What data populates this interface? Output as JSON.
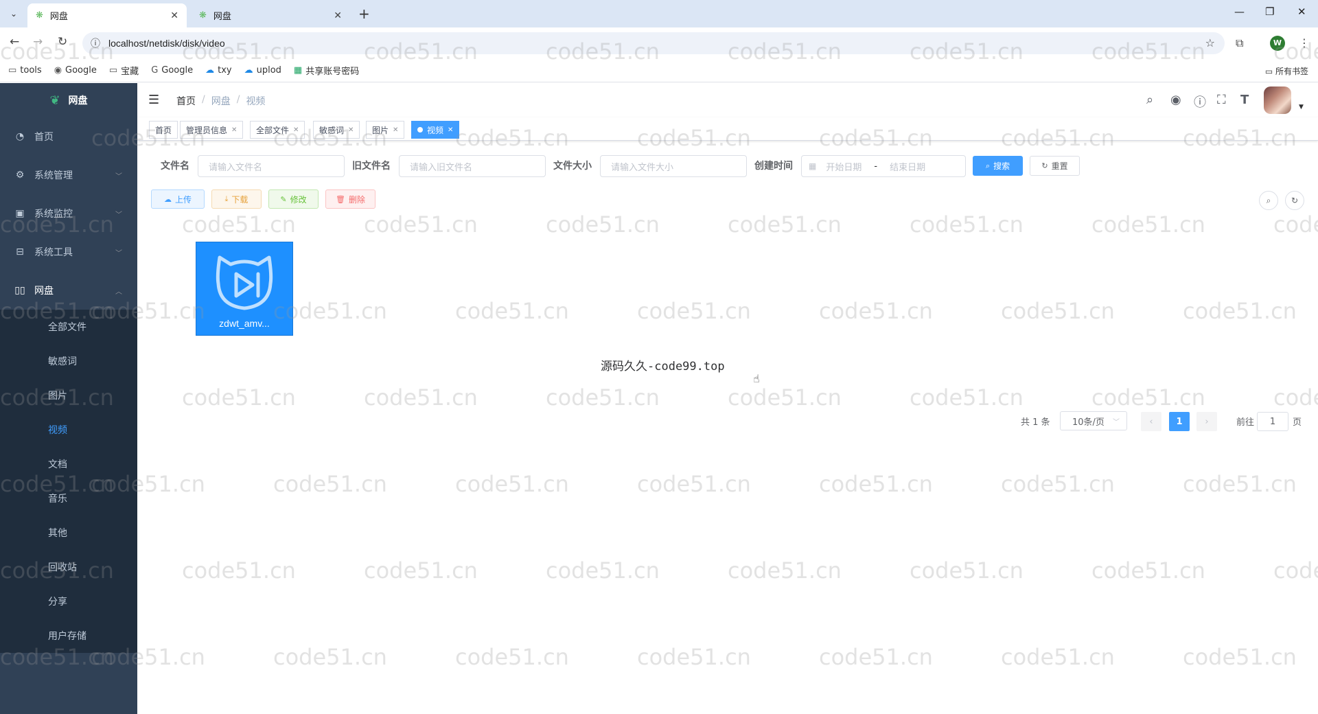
{
  "browser": {
    "tabs": [
      {
        "title": "网盘",
        "active": true
      },
      {
        "title": "网盘",
        "active": false
      }
    ],
    "url": "localhost/netdisk/disk/video",
    "profile_initial": "W",
    "bookmarks": [
      {
        "label": "tools",
        "icon": "folder-icon"
      },
      {
        "label": "Google",
        "icon": "globe-icon"
      },
      {
        "label": "宝藏",
        "icon": "folder-icon"
      },
      {
        "label": "Google",
        "icon": "google-icon"
      },
      {
        "label": "txy",
        "icon": "cloud-icon"
      },
      {
        "label": "uplod",
        "icon": "upload-cloud-icon"
      },
      {
        "label": "共享账号密码",
        "icon": "sheet-icon"
      }
    ],
    "all_bookmarks": "所有书签"
  },
  "app": {
    "logo_title": "网盘",
    "menu": [
      {
        "label": "首页",
        "icon": "dashboard-icon"
      },
      {
        "label": "系统管理",
        "icon": "gear-icon",
        "arrow": "down"
      },
      {
        "label": "系统监控",
        "icon": "monitor-icon",
        "arrow": "down"
      },
      {
        "label": "系统工具",
        "icon": "toolbox-icon",
        "arrow": "down"
      },
      {
        "label": "网盘",
        "icon": "book-icon",
        "arrow": "up"
      }
    ],
    "submenu": [
      "全部文件",
      "敏感词",
      "图片",
      "视频",
      "文档",
      "音乐",
      "其他",
      "回收站",
      "分享",
      "用户存储"
    ],
    "active_submenu": "视频",
    "breadcrumb": [
      "首页",
      "网盘",
      "视频"
    ],
    "tags": [
      {
        "label": "首页",
        "closable": false
      },
      {
        "label": "管理员信息",
        "closable": true
      },
      {
        "label": "全部文件",
        "closable": true
      },
      {
        "label": "敏感词",
        "closable": true
      },
      {
        "label": "图片",
        "closable": true
      },
      {
        "label": "视频",
        "closable": true,
        "active": true
      }
    ]
  },
  "search": {
    "filename_label": "文件名",
    "filename_placeholder": "请输入文件名",
    "oldname_label": "旧文件名",
    "oldname_placeholder": "请输入旧文件名",
    "size_label": "文件大小",
    "size_placeholder": "请输入文件大小",
    "created_label": "创建时间",
    "start_placeholder": "开始日期",
    "range_sep": "-",
    "end_placeholder": "结束日期",
    "search_btn": "搜索",
    "reset_btn": "重置"
  },
  "toolbar": {
    "upload": "上传",
    "download": "下载",
    "edit": "修改",
    "delete": "删除"
  },
  "files": [
    {
      "name": "zdwt_amv...",
      "type": "video"
    }
  ],
  "watermark_center": "源码久久-code99.top",
  "watermark_text": "code51.cn",
  "pagination": {
    "total": "共 1 条",
    "page_size": "10条/页",
    "current": "1",
    "goto_prefix": "前往",
    "goto_value": "1",
    "goto_suffix": "页"
  },
  "colors": {
    "sidebar_bg": "#304156",
    "primary": "#409eff"
  }
}
